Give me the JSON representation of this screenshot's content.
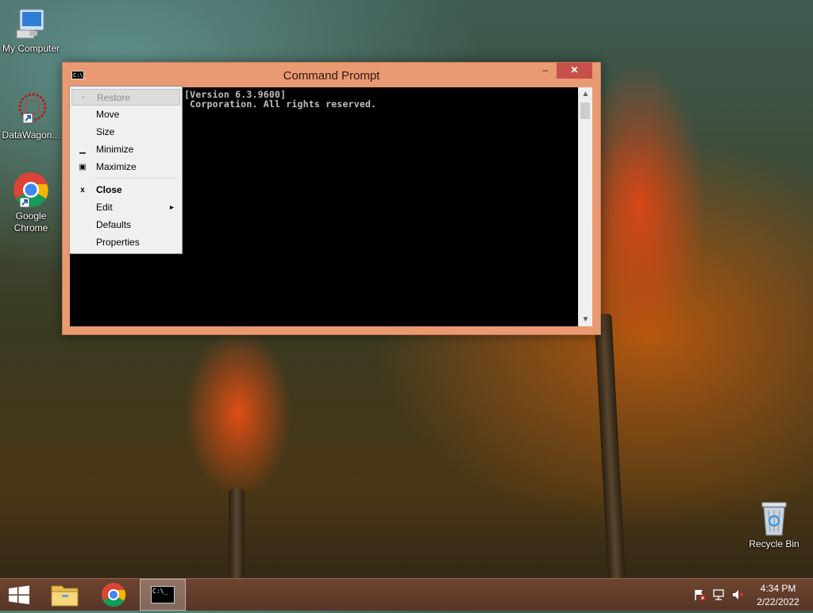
{
  "desktop": {
    "icons": [
      {
        "label": "My Computer"
      },
      {
        "label": "DataWagon..."
      },
      {
        "label": "Google Chrome"
      },
      {
        "label": "Recycle Bin"
      }
    ]
  },
  "window": {
    "title": "Command Prompt",
    "sys_icon_text": "C:\\_",
    "minimize": "–",
    "maximize": "□",
    "close": "✕",
    "console_lines": [
      "[Version 6.3.9600]",
      " Corporation. All rights reserved."
    ]
  },
  "menu": {
    "items": [
      {
        "label": "Restore",
        "icon": "▫",
        "state": "disabled"
      },
      {
        "label": "Move",
        "icon": "",
        "state": "normal"
      },
      {
        "label": "Size",
        "icon": "",
        "state": "normal"
      },
      {
        "label": "Minimize",
        "icon": "▁",
        "state": "normal"
      },
      {
        "label": "Maximize",
        "icon": "▣",
        "state": "normal"
      },
      {
        "label": "Close",
        "icon": "x",
        "state": "bold"
      },
      {
        "label": "Edit",
        "icon": "",
        "state": "normal",
        "submenu_arrow": "▸"
      },
      {
        "label": "Defaults",
        "icon": "",
        "state": "normal"
      },
      {
        "label": "Properties",
        "icon": "",
        "state": "normal"
      }
    ]
  },
  "taskbar": {
    "time": "4:34 PM",
    "date": "2/22/2022",
    "items": [
      "start-button",
      "file-explorer",
      "google-chrome",
      "command-prompt"
    ]
  },
  "colors": {
    "window_frame": "#e99a72",
    "close_button": "#c7504b",
    "console_bg": "#000000",
    "console_text": "#c0c0c0"
  }
}
